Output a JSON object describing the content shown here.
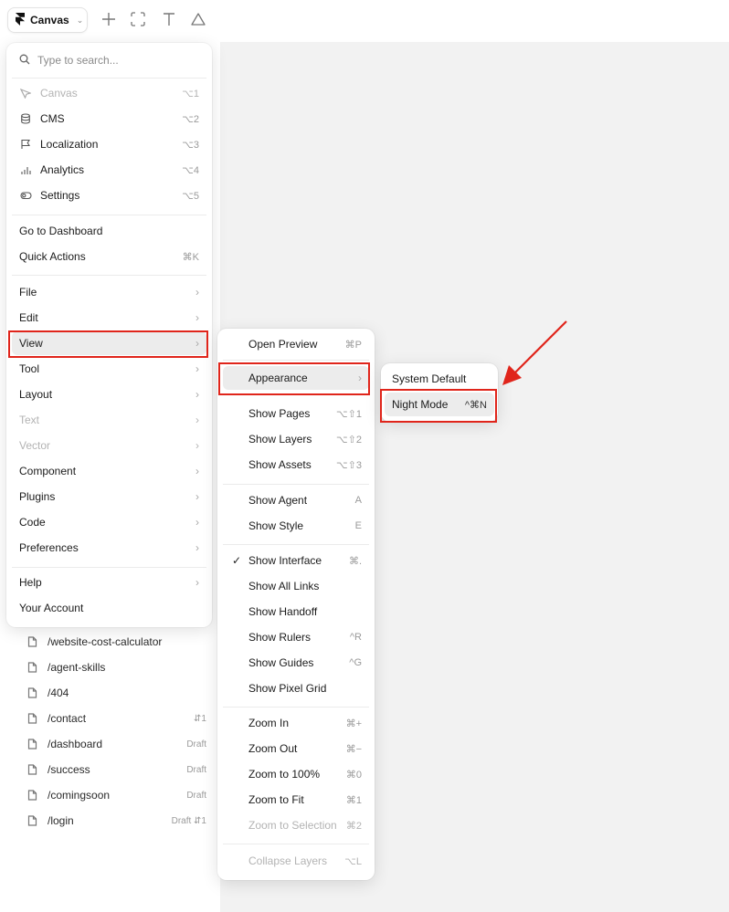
{
  "toolbar": {
    "canvas_label": "Canvas"
  },
  "search": {
    "placeholder": "Type to search..."
  },
  "modes": [
    {
      "label": "Canvas",
      "shortcut": "⌥1",
      "icon": "pointer-icon",
      "disabled": true
    },
    {
      "label": "CMS",
      "shortcut": "⌥2",
      "icon": "database-icon"
    },
    {
      "label": "Localization",
      "shortcut": "⌥3",
      "icon": "flag-icon"
    },
    {
      "label": "Analytics",
      "shortcut": "⌥4",
      "icon": "bar-chart-icon"
    },
    {
      "label": "Settings",
      "shortcut": "⌥5",
      "icon": "toggle-icon"
    }
  ],
  "actions": [
    {
      "label": "Go to Dashboard",
      "shortcut": ""
    },
    {
      "label": "Quick Actions",
      "shortcut": "⌘K"
    }
  ],
  "menus": [
    {
      "label": "File"
    },
    {
      "label": "Edit"
    },
    {
      "label": "View"
    },
    {
      "label": "Tool"
    },
    {
      "label": "Layout"
    },
    {
      "label": "Text"
    },
    {
      "label": "Vector"
    },
    {
      "label": "Component"
    },
    {
      "label": "Plugins"
    },
    {
      "label": "Code"
    },
    {
      "label": "Preferences"
    }
  ],
  "footer": [
    {
      "label": "Help"
    },
    {
      "label": "Your Account"
    }
  ],
  "view_menu": {
    "preview": {
      "label": "Open Preview",
      "shortcut": "⌘P"
    },
    "appearance": {
      "label": "Appearance"
    },
    "panels": [
      {
        "label": "Show Pages",
        "shortcut": "⌥⇧1"
      },
      {
        "label": "Show Layers",
        "shortcut": "⌥⇧2"
      },
      {
        "label": "Show Assets",
        "shortcut": "⌥⇧3"
      }
    ],
    "agent": [
      {
        "label": "Show Agent",
        "shortcut": "A"
      },
      {
        "label": "Show Style",
        "shortcut": "E"
      }
    ],
    "display": [
      {
        "label": "Show Interface",
        "shortcut": "⌘.",
        "checked": true
      },
      {
        "label": "Show All Links",
        "shortcut": ""
      },
      {
        "label": "Show Handoff",
        "shortcut": ""
      },
      {
        "label": "Show Rulers",
        "shortcut": "^R"
      },
      {
        "label": "Show Guides",
        "shortcut": "^G"
      },
      {
        "label": "Show Pixel Grid",
        "shortcut": ""
      }
    ],
    "zoom": [
      {
        "label": "Zoom In",
        "shortcut": "⌘+"
      },
      {
        "label": "Zoom Out",
        "shortcut": "⌘−"
      },
      {
        "label": "Zoom to 100%",
        "shortcut": "⌘0"
      },
      {
        "label": "Zoom to Fit",
        "shortcut": "⌘1"
      },
      {
        "label": "Zoom to Selection",
        "shortcut": "⌘2"
      }
    ],
    "collapse": {
      "label": "Collapse Layers",
      "shortcut": "⌥L"
    }
  },
  "appearance_menu": {
    "system_default": "System Default",
    "night_mode": "Night Mode",
    "night_mode_shortcut": "^⌘N"
  },
  "pages": [
    {
      "path": "/website-cost-calculator",
      "status": ""
    },
    {
      "path": "/agent-skills",
      "status": ""
    },
    {
      "path": "/404",
      "status": ""
    },
    {
      "path": "/contact",
      "status": "⇵1"
    },
    {
      "path": "/dashboard",
      "status": "Draft"
    },
    {
      "path": "/success",
      "status": "Draft"
    },
    {
      "path": "/comingsoon",
      "status": "Draft"
    },
    {
      "path": "/login",
      "status": "Draft ⇵1"
    }
  ],
  "colors": {
    "highlight_box": "#e0251b",
    "canvas_bg": "#f2f2f2"
  }
}
